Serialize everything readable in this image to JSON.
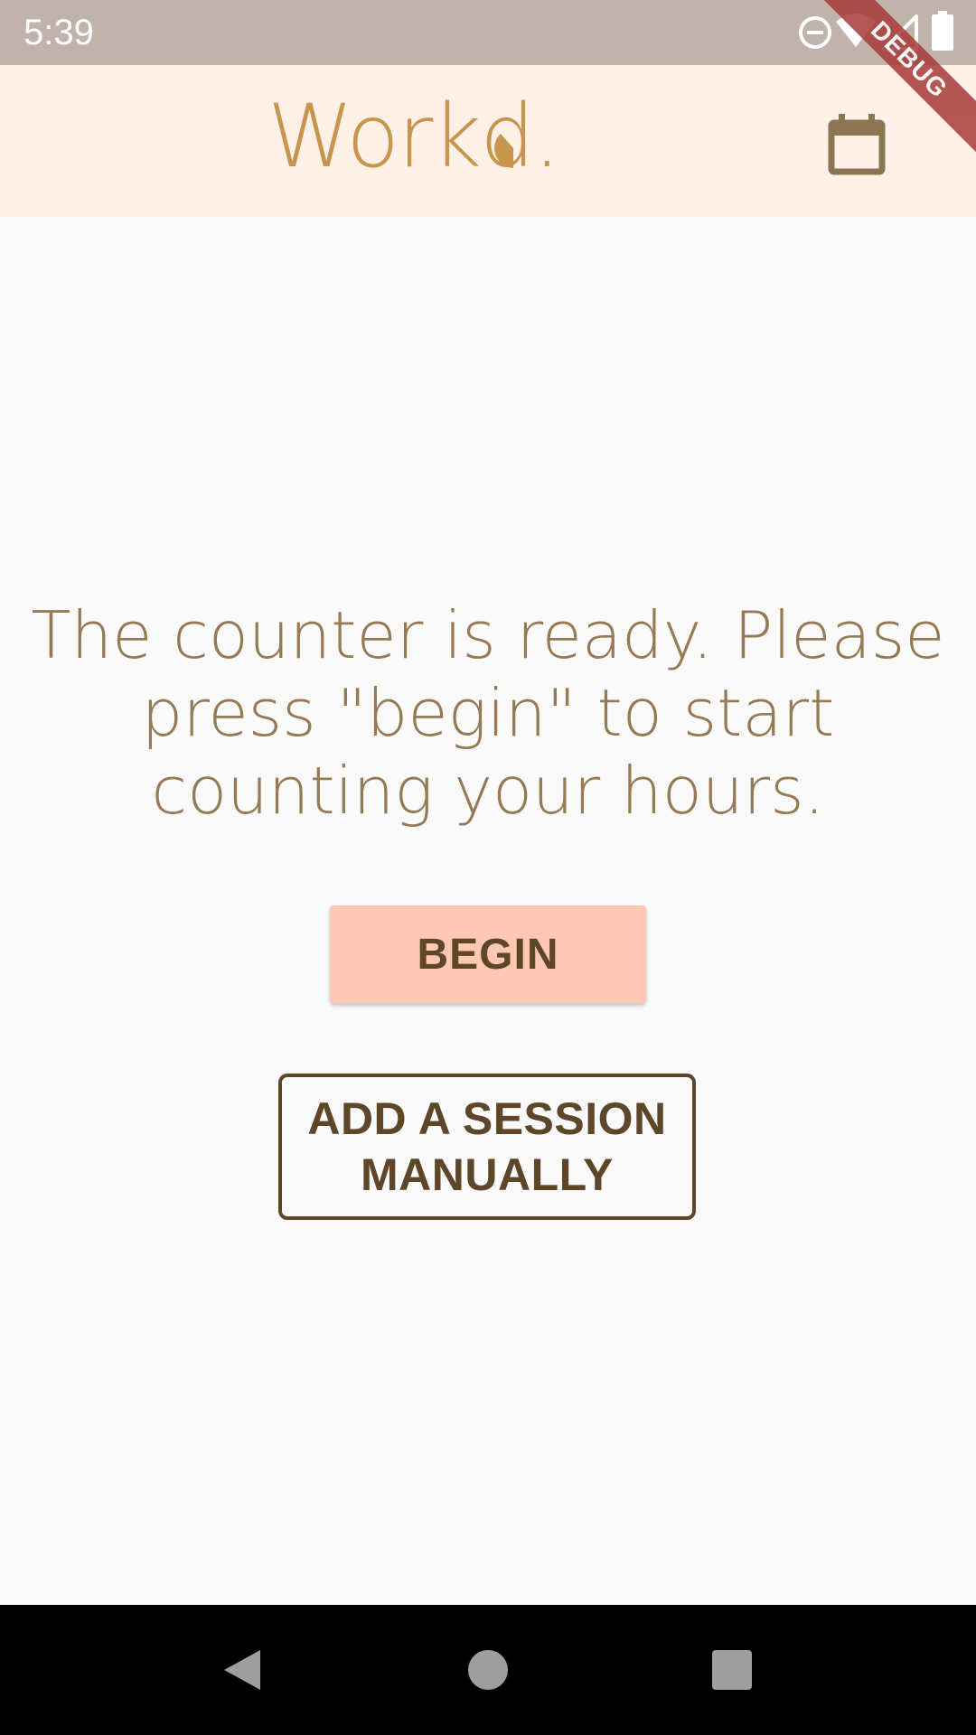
{
  "status_bar": {
    "time": "5:39",
    "icons": [
      "do-not-disturb-icon",
      "wifi-icon",
      "signal-icon",
      "battery-icon"
    ]
  },
  "debug_banner": {
    "label": "DEBUG"
  },
  "app_bar": {
    "logo_text": "Workd.",
    "logo_color": "#c8954c",
    "background": "#fff0e8",
    "calendar_icon": "calendar-icon"
  },
  "main": {
    "message": "The counter is ready. Please press \"begin\" to start counting your hours.",
    "begin_label": "BEGIN",
    "add_session_label": "ADD A SESSION MANUALLY"
  },
  "nav_bar": {
    "buttons": [
      "back-icon",
      "home-icon",
      "recents-icon"
    ]
  },
  "colors": {
    "status_bar": "#c0b3ab",
    "message_text": "#967a55",
    "button_fill": "#ffc8b5",
    "button_text": "#5e4628",
    "background": "#fafafa"
  }
}
